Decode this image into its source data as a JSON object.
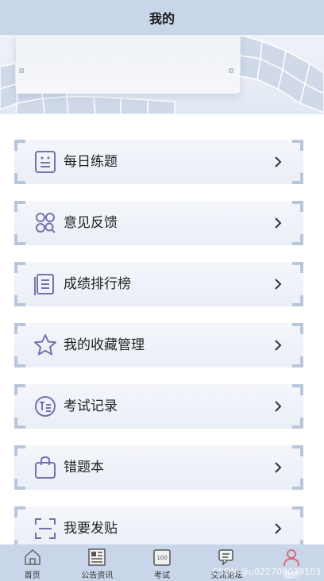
{
  "header": {
    "title": "我的"
  },
  "menu": {
    "items": [
      {
        "label": "每日练题",
        "icon": "quiz-icon"
      },
      {
        "label": "意见反馈",
        "icon": "feedback-icon"
      },
      {
        "label": "成绩排行榜",
        "icon": "ranking-icon"
      },
      {
        "label": "我的收藏管理",
        "icon": "star-icon"
      },
      {
        "label": "考试记录",
        "icon": "record-icon"
      },
      {
        "label": "错题本",
        "icon": "bag-icon"
      },
      {
        "label": "我要发贴",
        "icon": "scan-icon"
      }
    ]
  },
  "tabbar": {
    "items": [
      {
        "label": "首页",
        "icon": "home-icon"
      },
      {
        "label": "公告资讯",
        "icon": "news-icon"
      },
      {
        "label": "考试",
        "icon": "exam-icon"
      },
      {
        "label": "交流论坛",
        "icon": "chat-icon"
      },
      {
        "label": "我的",
        "icon": "user-icon",
        "active": true
      }
    ]
  },
  "watermark": "CSDN @u022709039103",
  "colors": {
    "bar": "#c9d6ea",
    "icon": "#6f6fae",
    "active": "#e0606a"
  }
}
